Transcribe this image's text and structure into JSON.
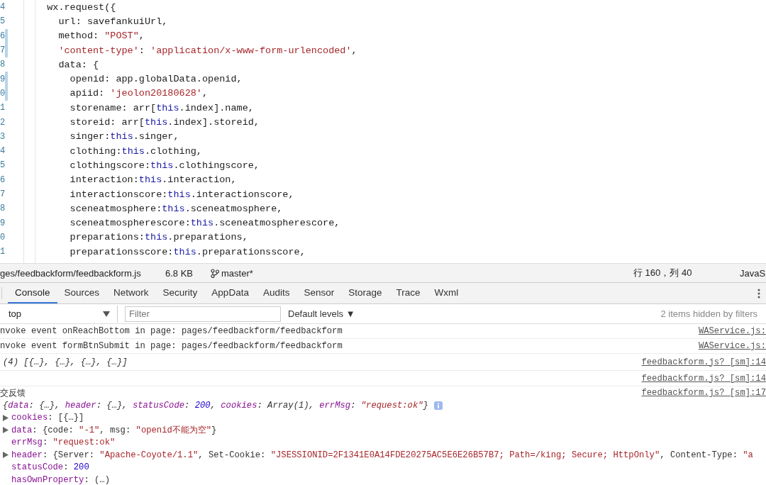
{
  "editor": {
    "lines": [
      {
        "number": "4",
        "changed": false,
        "tokens": [
          {
            "text": "  wx.request({",
            "kind": "plain"
          }
        ]
      },
      {
        "number": "5",
        "changed": false,
        "tokens": [
          {
            "text": "    url: savefankuiUrl,",
            "kind": "plain"
          }
        ]
      },
      {
        "number": "6",
        "changed": true,
        "tokens": [
          {
            "text": "    method: ",
            "kind": "plain"
          },
          {
            "text": "\"POST\"",
            "kind": "string"
          },
          {
            "text": ",",
            "kind": "plain"
          }
        ]
      },
      {
        "number": "7",
        "changed": true,
        "tokens": [
          {
            "text": "    'content-type'",
            "kind": "string"
          },
          {
            "text": ": ",
            "kind": "plain"
          },
          {
            "text": "'application/x-www-form-urlencoded'",
            "kind": "string"
          },
          {
            "text": ",",
            "kind": "plain"
          }
        ]
      },
      {
        "number": "8",
        "changed": false,
        "tokens": [
          {
            "text": "    data: {",
            "kind": "plain"
          }
        ]
      },
      {
        "number": "9",
        "changed": true,
        "tokens": [
          {
            "text": "      openid: app.globalData.openid,",
            "kind": "plain"
          }
        ]
      },
      {
        "number": "0",
        "changed": true,
        "tokens": [
          {
            "text": "      apiid: ",
            "kind": "plain"
          },
          {
            "text": "'jeolon20180628'",
            "kind": "string"
          },
          {
            "text": ",",
            "kind": "plain"
          }
        ]
      },
      {
        "number": "1",
        "changed": false,
        "tokens": [
          {
            "text": "      storename: arr[",
            "kind": "plain"
          },
          {
            "text": "this",
            "kind": "keyword"
          },
          {
            "text": ".index].name,",
            "kind": "plain"
          }
        ]
      },
      {
        "number": "2",
        "changed": false,
        "tokens": [
          {
            "text": "      storeid: arr[",
            "kind": "plain"
          },
          {
            "text": "this",
            "kind": "keyword"
          },
          {
            "text": ".index].storeid,",
            "kind": "plain"
          }
        ]
      },
      {
        "number": "3",
        "changed": false,
        "tokens": [
          {
            "text": "      singer:",
            "kind": "plain"
          },
          {
            "text": "this",
            "kind": "keyword"
          },
          {
            "text": ".singer,",
            "kind": "plain"
          }
        ]
      },
      {
        "number": "4",
        "changed": false,
        "tokens": [
          {
            "text": "      clothing:",
            "kind": "plain"
          },
          {
            "text": "this",
            "kind": "keyword"
          },
          {
            "text": ".clothing,",
            "kind": "plain"
          }
        ]
      },
      {
        "number": "5",
        "changed": false,
        "tokens": [
          {
            "text": "      clothingscore:",
            "kind": "plain"
          },
          {
            "text": "this",
            "kind": "keyword"
          },
          {
            "text": ".clothingscore,",
            "kind": "plain"
          }
        ]
      },
      {
        "number": "6",
        "changed": false,
        "tokens": [
          {
            "text": "      interaction:",
            "kind": "plain"
          },
          {
            "text": "this",
            "kind": "keyword"
          },
          {
            "text": ".interaction,",
            "kind": "plain"
          }
        ]
      },
      {
        "number": "7",
        "changed": false,
        "tokens": [
          {
            "text": "      interactionscore:",
            "kind": "plain"
          },
          {
            "text": "this",
            "kind": "keyword"
          },
          {
            "text": ".interactionscore,",
            "kind": "plain"
          }
        ]
      },
      {
        "number": "8",
        "changed": false,
        "tokens": [
          {
            "text": "      sceneatmosphere:",
            "kind": "plain"
          },
          {
            "text": "this",
            "kind": "keyword"
          },
          {
            "text": ".sceneatmosphere,",
            "kind": "plain"
          }
        ]
      },
      {
        "number": "9",
        "changed": false,
        "tokens": [
          {
            "text": "      sceneatmospherescore:",
            "kind": "plain"
          },
          {
            "text": "this",
            "kind": "keyword"
          },
          {
            "text": ".sceneatmospherescore,",
            "kind": "plain"
          }
        ]
      },
      {
        "number": "0",
        "changed": false,
        "tokens": [
          {
            "text": "      preparations:",
            "kind": "plain"
          },
          {
            "text": "this",
            "kind": "keyword"
          },
          {
            "text": ".preparations,",
            "kind": "plain"
          }
        ]
      },
      {
        "number": "1",
        "changed": false,
        "tokens": [
          {
            "text": "      preparationsscore:",
            "kind": "plain"
          },
          {
            "text": "this",
            "kind": "keyword"
          },
          {
            "text": ".preparationsscore,",
            "kind": "plain"
          }
        ]
      }
    ]
  },
  "status_bar": {
    "file": "ges/feedbackform/feedbackform.js",
    "size": "6.8 KB",
    "branch": "master*",
    "position": "行 160，列 40",
    "language": "JavaS"
  },
  "tabs": [
    {
      "label": "Console",
      "selected": true
    },
    {
      "label": "Sources",
      "selected": false
    },
    {
      "label": "Network",
      "selected": false
    },
    {
      "label": "Security",
      "selected": false
    },
    {
      "label": "AppData",
      "selected": false
    },
    {
      "label": "Audits",
      "selected": false
    },
    {
      "label": "Sensor",
      "selected": false
    },
    {
      "label": "Storage",
      "selected": false
    },
    {
      "label": "Trace",
      "selected": false
    },
    {
      "label": "Wxml",
      "selected": false
    }
  ],
  "toolbar": {
    "context": "top",
    "filter": {
      "placeholder": "Filter"
    },
    "levels": "Default levels ▼",
    "hidden_note": "2 items hidden by filters"
  },
  "console": {
    "messages": [
      {
        "kind": "text",
        "text": "nvoke event onReachBottom in page: pages/feedbackform/feedbackform",
        "source": "WAService.js:"
      },
      {
        "kind": "text",
        "text": "nvoke event formBtnSubmit in page: pages/feedbackform/feedbackform",
        "source": "WAService.js:"
      },
      {
        "kind": "summary",
        "text": "(4) [{…}, {…}, {…}, {…}]",
        "source": "feedbackform.js? [sm]:14"
      },
      {
        "kind": "empty",
        "source": "feedbackform.js? [sm]:14"
      },
      {
        "kind": "object",
        "text": "交反馈",
        "source": "feedbackform.js? [sm]:17",
        "summary": [
          {
            "text": "{",
            "kind": "plain"
          },
          {
            "text": "data",
            "kind": "key"
          },
          {
            "text": ": {…}, ",
            "kind": "plain"
          },
          {
            "text": "header",
            "kind": "key"
          },
          {
            "text": ": {…}, ",
            "kind": "plain"
          },
          {
            "text": "statusCode",
            "kind": "key"
          },
          {
            "text": ": ",
            "kind": "plain"
          },
          {
            "text": "200",
            "kind": "number"
          },
          {
            "text": ", ",
            "kind": "plain"
          },
          {
            "text": "cookies",
            "kind": "key"
          },
          {
            "text": ": Array(1), ",
            "kind": "plain"
          },
          {
            "text": "errMsg",
            "kind": "key"
          },
          {
            "text": ": ",
            "kind": "plain"
          },
          {
            "text": "\"request:ok\"",
            "kind": "string"
          },
          {
            "text": "}",
            "kind": "plain"
          }
        ],
        "properties": [
          {
            "name": "cookies",
            "expandable": true,
            "value": [
              {
                "text": ": [{…}]",
                "kind": "plain"
              }
            ]
          },
          {
            "name": "data",
            "expandable": true,
            "value": [
              {
                "text": ": {code: ",
                "kind": "plain"
              },
              {
                "text": "\"-1\"",
                "kind": "string"
              },
              {
                "text": ", msg: ",
                "kind": "plain"
              },
              {
                "text": "\"openid不能为空\"",
                "kind": "string"
              },
              {
                "text": "}",
                "kind": "plain"
              }
            ]
          },
          {
            "name": "errMsg",
            "expandable": false,
            "value": [
              {
                "text": ": ",
                "kind": "plain"
              },
              {
                "text": "\"request:ok\"",
                "kind": "string"
              }
            ]
          },
          {
            "name": "header",
            "expandable": true,
            "value": [
              {
                "text": ": {Server: ",
                "kind": "plain"
              },
              {
                "text": "\"Apache-Coyote/1.1\"",
                "kind": "string"
              },
              {
                "text": ", Set-Cookie: ",
                "kind": "plain"
              },
              {
                "text": "\"JSESSIONID=2F1341E0A14FDE20275AC5E6E26B57B7; Path=/king; Secure; HttpOnly\"",
                "kind": "string"
              },
              {
                "text": ", Content-Type: ",
                "kind": "plain"
              },
              {
                "text": "\"a",
                "kind": "string"
              }
            ]
          },
          {
            "name": "statusCode",
            "expandable": false,
            "value": [
              {
                "text": ": ",
                "kind": "plain"
              },
              {
                "text": "200",
                "kind": "number"
              }
            ]
          },
          {
            "name": "hasOwnProperty",
            "expandable": false,
            "value": [
              {
                "text": ": (…)",
                "kind": "plain"
              }
            ]
          }
        ]
      }
    ]
  }
}
